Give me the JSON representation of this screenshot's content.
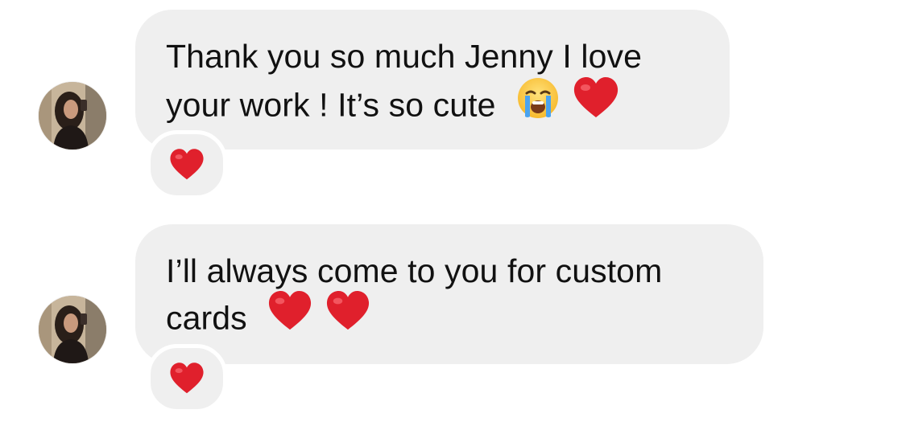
{
  "messages": [
    {
      "lines": [
        "Thank you so much Jenny I love",
        "your work ! It’s so cute"
      ],
      "trailing_emoji": [
        "loudly-crying-face",
        "red-heart"
      ],
      "reaction": "red-heart"
    },
    {
      "lines": [
        "I’ll always come to you for custom",
        "cards"
      ],
      "trailing_emoji": [
        "red-heart",
        "red-heart"
      ],
      "reaction": "red-heart"
    }
  ],
  "colors": {
    "bubble": "#efefef",
    "text": "#111111",
    "heart": "#e0202c",
    "background": "#ffffff"
  }
}
